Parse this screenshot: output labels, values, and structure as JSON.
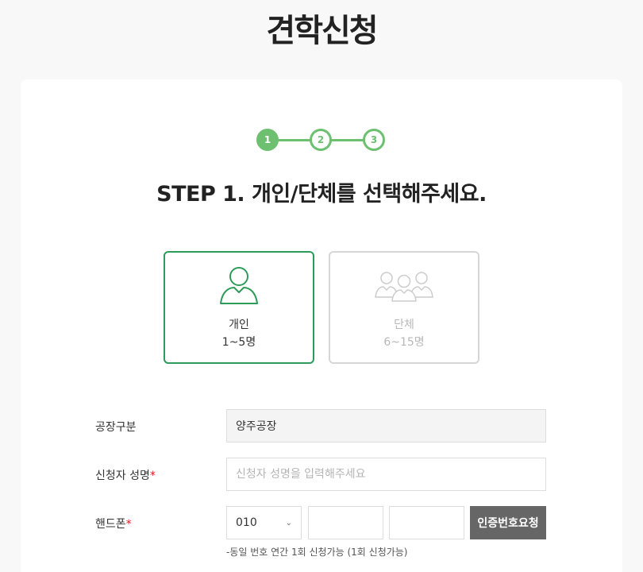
{
  "page": {
    "title": "견학신청"
  },
  "stepper": {
    "steps": [
      "1",
      "2",
      "3"
    ],
    "current": 1
  },
  "step_heading": "STEP 1. 개인/단체를 선택해주세요.",
  "types": [
    {
      "label": "개인",
      "range": "1~5명",
      "selected": true
    },
    {
      "label": "단체",
      "range": "6~15명",
      "selected": false
    }
  ],
  "form": {
    "factory": {
      "label": "공장구분",
      "value": "양주공장"
    },
    "name": {
      "label": "신청자 성명",
      "required_mark": "*",
      "placeholder": "신청자 성명을 입력해주세요"
    },
    "phone": {
      "label": "핸드폰",
      "required_mark": "*",
      "prefix": "010",
      "verify_label": "인증번호요청",
      "hint": "-동일 번호 연간 1회 신청가능 (1회 신청가능)"
    }
  },
  "colors": {
    "accent": "#6cc070",
    "selected_border": "#2e9b5a",
    "required": "#e01b1b",
    "button": "#666666"
  }
}
